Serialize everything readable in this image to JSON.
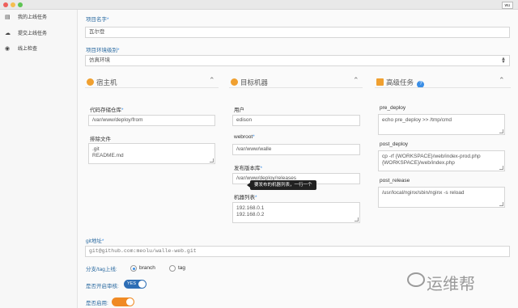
{
  "window": {
    "badge": "wu"
  },
  "sidebar": {
    "items": [
      {
        "label": "我的上线任务",
        "icon": "list-icon"
      },
      {
        "label": "提交上线任务",
        "icon": "upload-icon"
      },
      {
        "label": "线上检查",
        "icon": "eye-icon"
      }
    ]
  },
  "form": {
    "project_name": {
      "label": "项目名字",
      "required": "*",
      "value": "瓦尔登"
    },
    "env_level": {
      "label": "项目环境级别",
      "required": "*",
      "value": "仿真环境"
    },
    "host_panel": {
      "title": "宿主机",
      "repo_label": "代码存储仓库",
      "repo_required": "*",
      "repo_value": "/var/www/deploy/from",
      "exclude_label": "排除文件",
      "exclude_value": ".git\nREADME.md"
    },
    "target_panel": {
      "title": "目标机器",
      "user_label": "用户",
      "user_value": "edison",
      "webroot_label": "webroot",
      "webroot_required": "*",
      "webroot_value": "/var/www/walle",
      "releases_label": "发布版本库",
      "releases_required": "*",
      "releases_value": "/var/www/deploy/releases",
      "machines_label": "机器列表",
      "machines_required": "*",
      "machines_value": "192.168.0.1\n192.168.0.2",
      "tooltip": "要发布的机器列表，一行一个"
    },
    "advanced_panel": {
      "title": "高级任务",
      "pre_deploy_label": "pre_deploy",
      "pre_deploy_value": "echo pre_deploy >> /tmp/cmd",
      "post_deploy_label": "post_deploy",
      "post_deploy_value": "cp -rf {WORKSPACE}/web/index-prod.php\n{WORKSPACE}/web/index.php",
      "post_release_label": "post_release",
      "post_release_value": "/usr/local/nginx/sbin/nginx -s reload"
    },
    "git_url": {
      "label": "git地址",
      "required": "*",
      "value": "git@github.com:meolu/walle-web.git"
    },
    "branch_tag": {
      "label": "分支/tag上线:",
      "options": [
        "branch",
        "tag"
      ],
      "selected": "branch"
    },
    "audit": {
      "label": "是否开启审核:",
      "value": "YES"
    },
    "enabled": {
      "label": "是否启用:"
    }
  },
  "watermark": {
    "text": "运维帮"
  },
  "colors": {
    "accent": "#3a8ee6",
    "label": "#2b6aa0",
    "toggle_blue": "#2d6eb5",
    "toggle_orange": "#f08a24"
  }
}
